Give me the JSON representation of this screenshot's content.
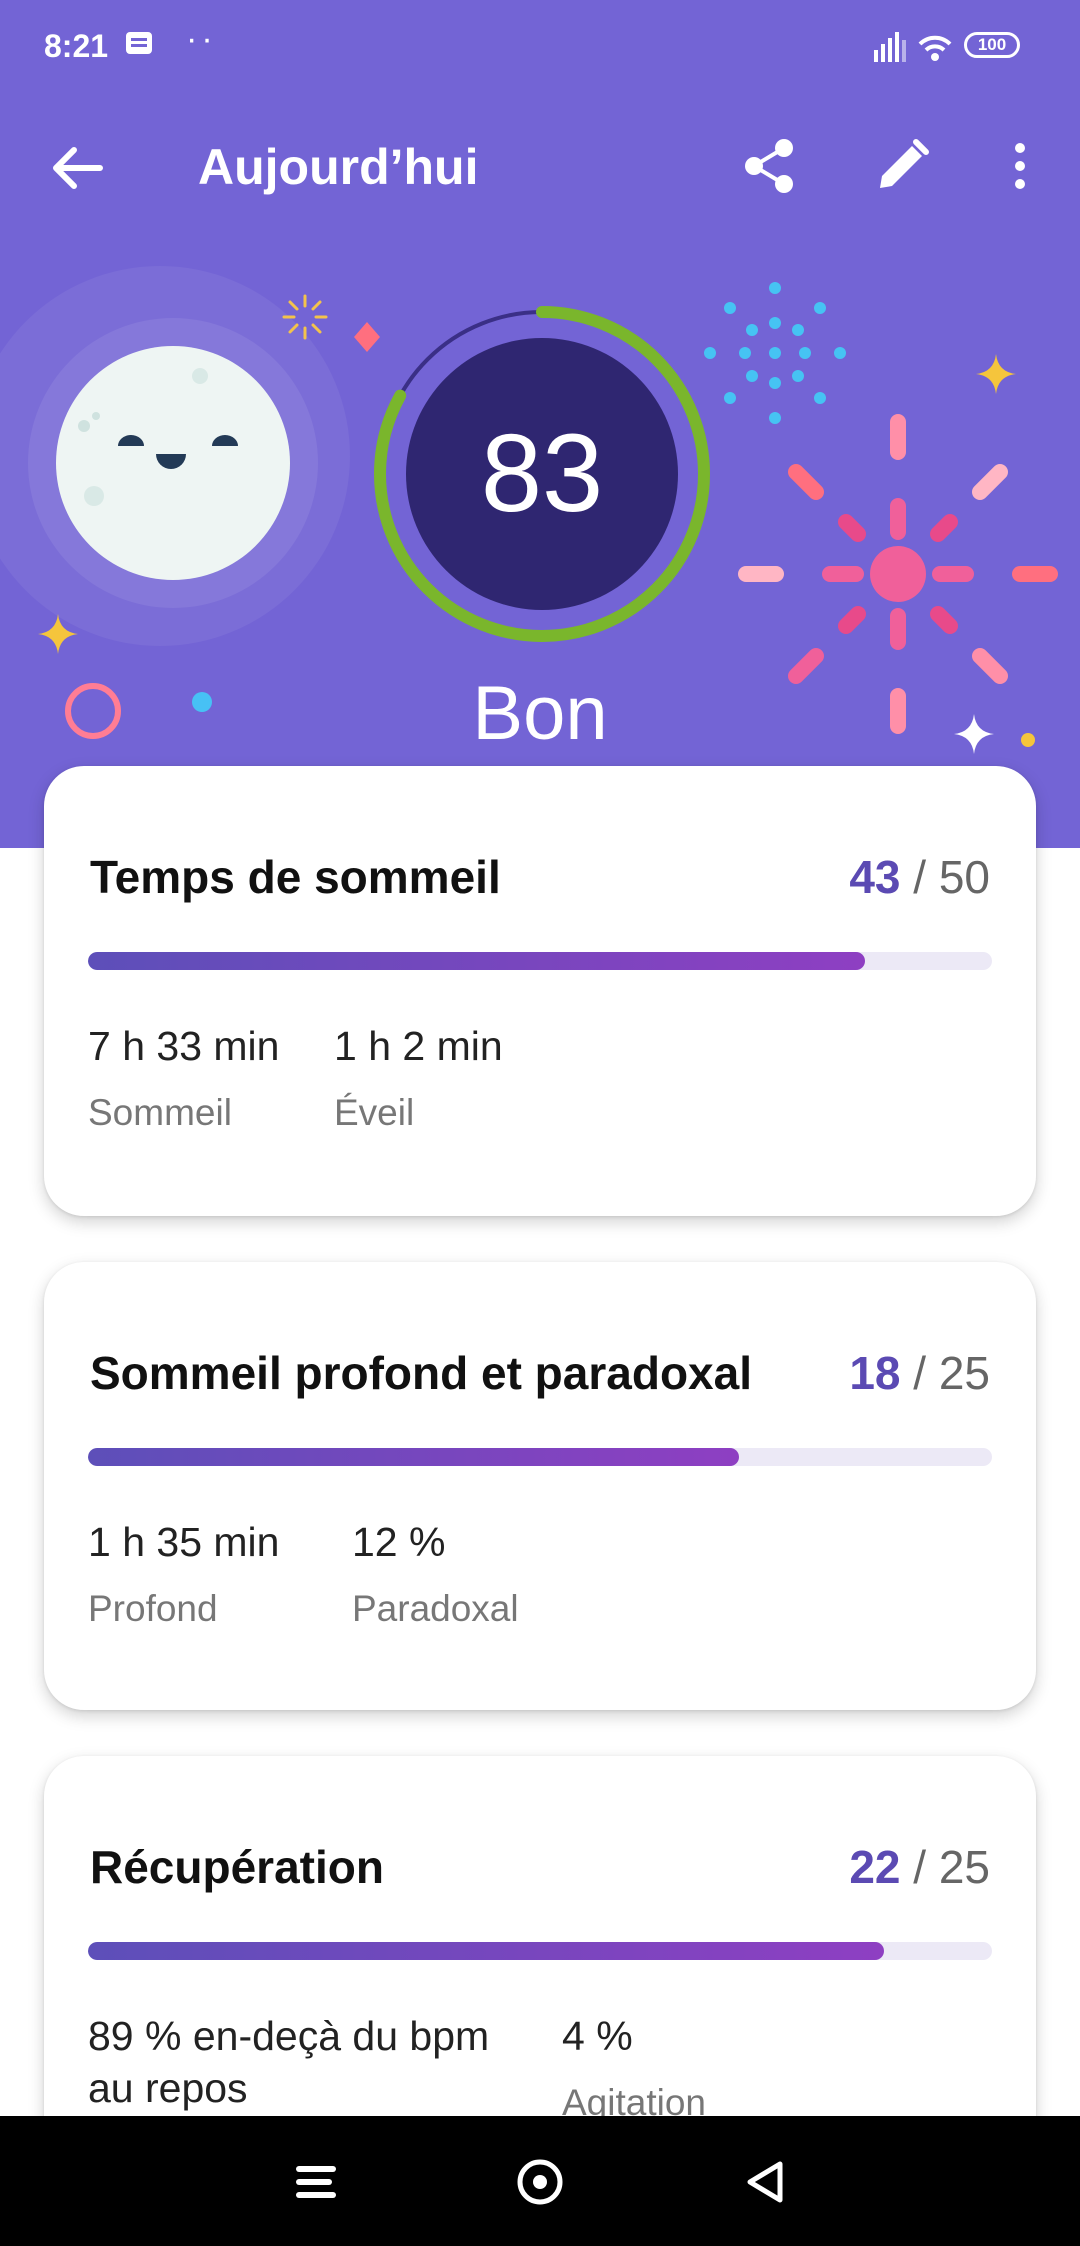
{
  "status_bar": {
    "time": "8:21",
    "dots": "··",
    "battery": "100"
  },
  "app_bar": {
    "title": "Aujourd’hui"
  },
  "summary": {
    "score": "83",
    "score_fraction": 0.83,
    "rating": "Bon",
    "ring_color": "#7ab62c"
  },
  "cards": [
    {
      "title": "Temps de sommeil",
      "score": "43",
      "separator": " / ",
      "max": "50",
      "progress": 0.86,
      "stats": [
        {
          "value": "7 h 33 min",
          "label": "Sommeil"
        },
        {
          "value": "1 h 2 min",
          "label": "Éveil"
        }
      ]
    },
    {
      "title": "Sommeil profond et paradoxal",
      "score": "18",
      "separator": " / ",
      "max": "25",
      "progress": 0.72,
      "stats": [
        {
          "value": "1 h 35 min",
          "label": "Profond"
        },
        {
          "value": "12 %",
          "label": "Paradoxal"
        }
      ]
    },
    {
      "title": "Récupération",
      "score": "22",
      "separator": " / ",
      "max": "25",
      "progress": 0.88,
      "stats": [
        {
          "value": "89 % en-deçà du bpm\nau repos",
          "label": ""
        },
        {
          "value": "4 %",
          "label": "Agitation"
        }
      ]
    }
  ],
  "colors": {
    "header_bg": "#7364d5",
    "accent": "#5b4ab3",
    "bar_gradient_start": "#5d4fb9",
    "bar_gradient_end": "#8e3fc2"
  },
  "icons": [
    "back-arrow-icon",
    "share-icon",
    "edit-pencil-icon",
    "more-vert-icon",
    "moon-face-icon",
    "menu-icon",
    "home-circle-icon",
    "back-triangle-icon"
  ]
}
